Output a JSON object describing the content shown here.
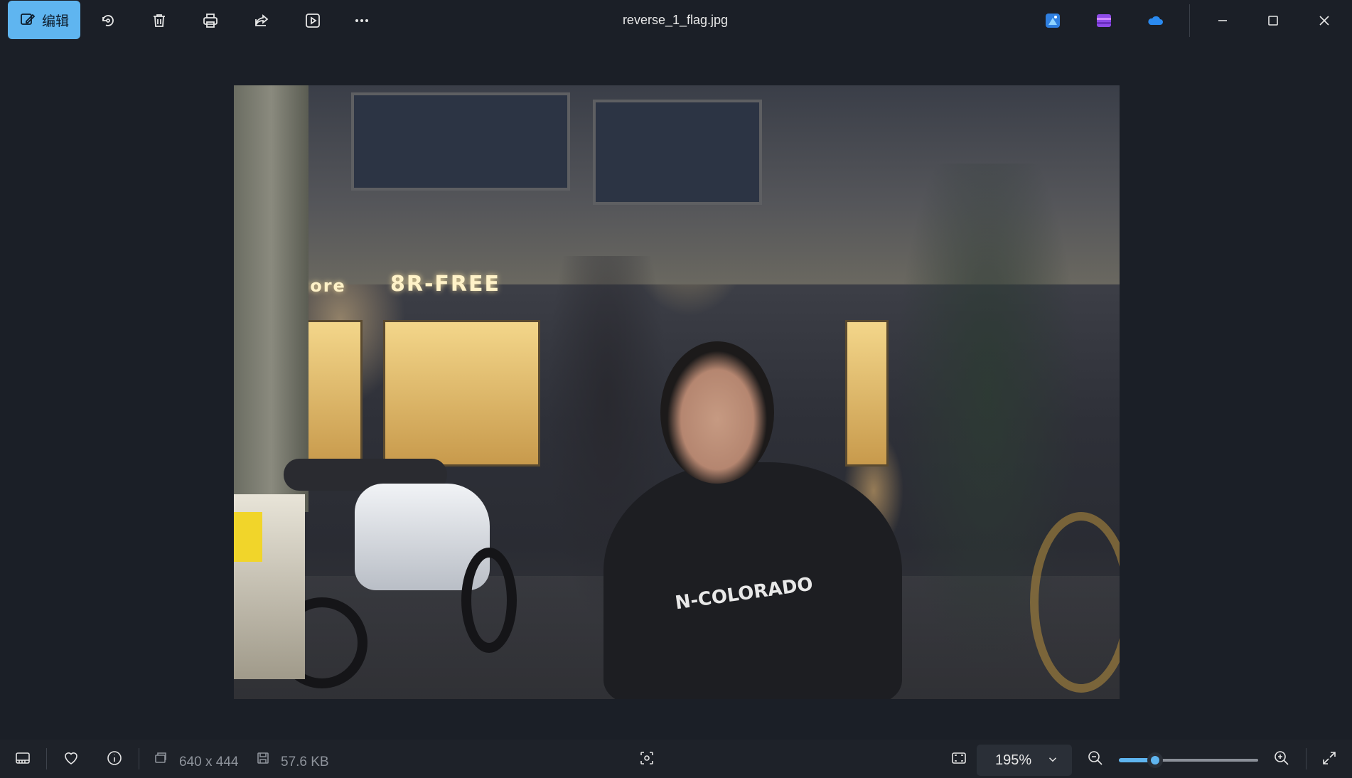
{
  "toolbar": {
    "edit_label": "编辑",
    "file_name": "reverse_1_flag.jpg",
    "icons": [
      "edit-icon",
      "rotate-icon",
      "delete-icon",
      "print-icon",
      "share-icon",
      "slideshow-icon",
      "more-icon"
    ],
    "app_icons": [
      "designer-icon",
      "clipchamp-icon",
      "onedrive-icon"
    ],
    "window_controls": [
      "minimize-icon",
      "maximize-icon",
      "close-icon"
    ]
  },
  "photo": {
    "description_signs": {
      "sign_left": "ımore",
      "sign_right": "8R-FREE",
      "hoodie_text": "N-COLORADO"
    }
  },
  "statusbar": {
    "dimensions": "640 x 444",
    "file_size": "57.6 KB",
    "zoom": "195%",
    "zoom_fraction": 0.26
  },
  "colors": {
    "accent": "#5fb5f0",
    "background": "#1b1f27",
    "bar": "#1e2229"
  }
}
